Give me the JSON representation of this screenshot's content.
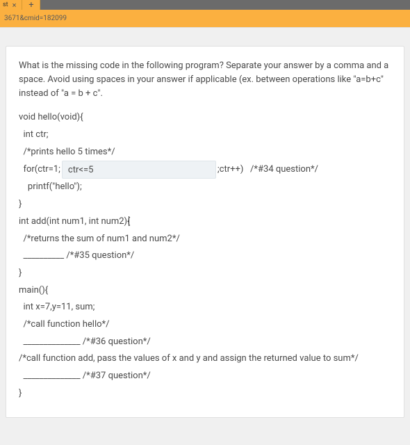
{
  "browser": {
    "tab_label_fragment": "st",
    "url_fragment": "3671&cmid=182099"
  },
  "question": {
    "prompt": "What is the missing code in the following program? Separate your answer by a comma and a space. Avoid using spaces in your answer if applicable (ex. between operations like \"a=b+c\" instead of \"a = b + c\"."
  },
  "code": {
    "l1": "void hello(void){",
    "l2": "  int ctr;",
    "l3": "  /*prints hello 5 times*/",
    "l4_pre": "  for(ctr=1;",
    "l4_input_value": "ctr<=5",
    "l4_post": ";ctr++)   /*#34 question*/",
    "l5": "    printf(\"hello\");",
    "l6": "}",
    "l7": "int add(int num1, int num2){",
    "l8": "  /*returns the sum of num1 and num2*/",
    "l9": "  __________ /*#35 question*/",
    "l10": "}",
    "l11": "main(){",
    "l12": "  int x=7,y=11, sum;",
    "l13": "  /*call function hello*/",
    "l14": "  ______________ /*#36 question*/",
    "l15": "  /*call function add, pass the values of x and y and assign the returned value to sum*/",
    "l16": "  ______________ /*#37 question*/",
    "l17": "}"
  }
}
